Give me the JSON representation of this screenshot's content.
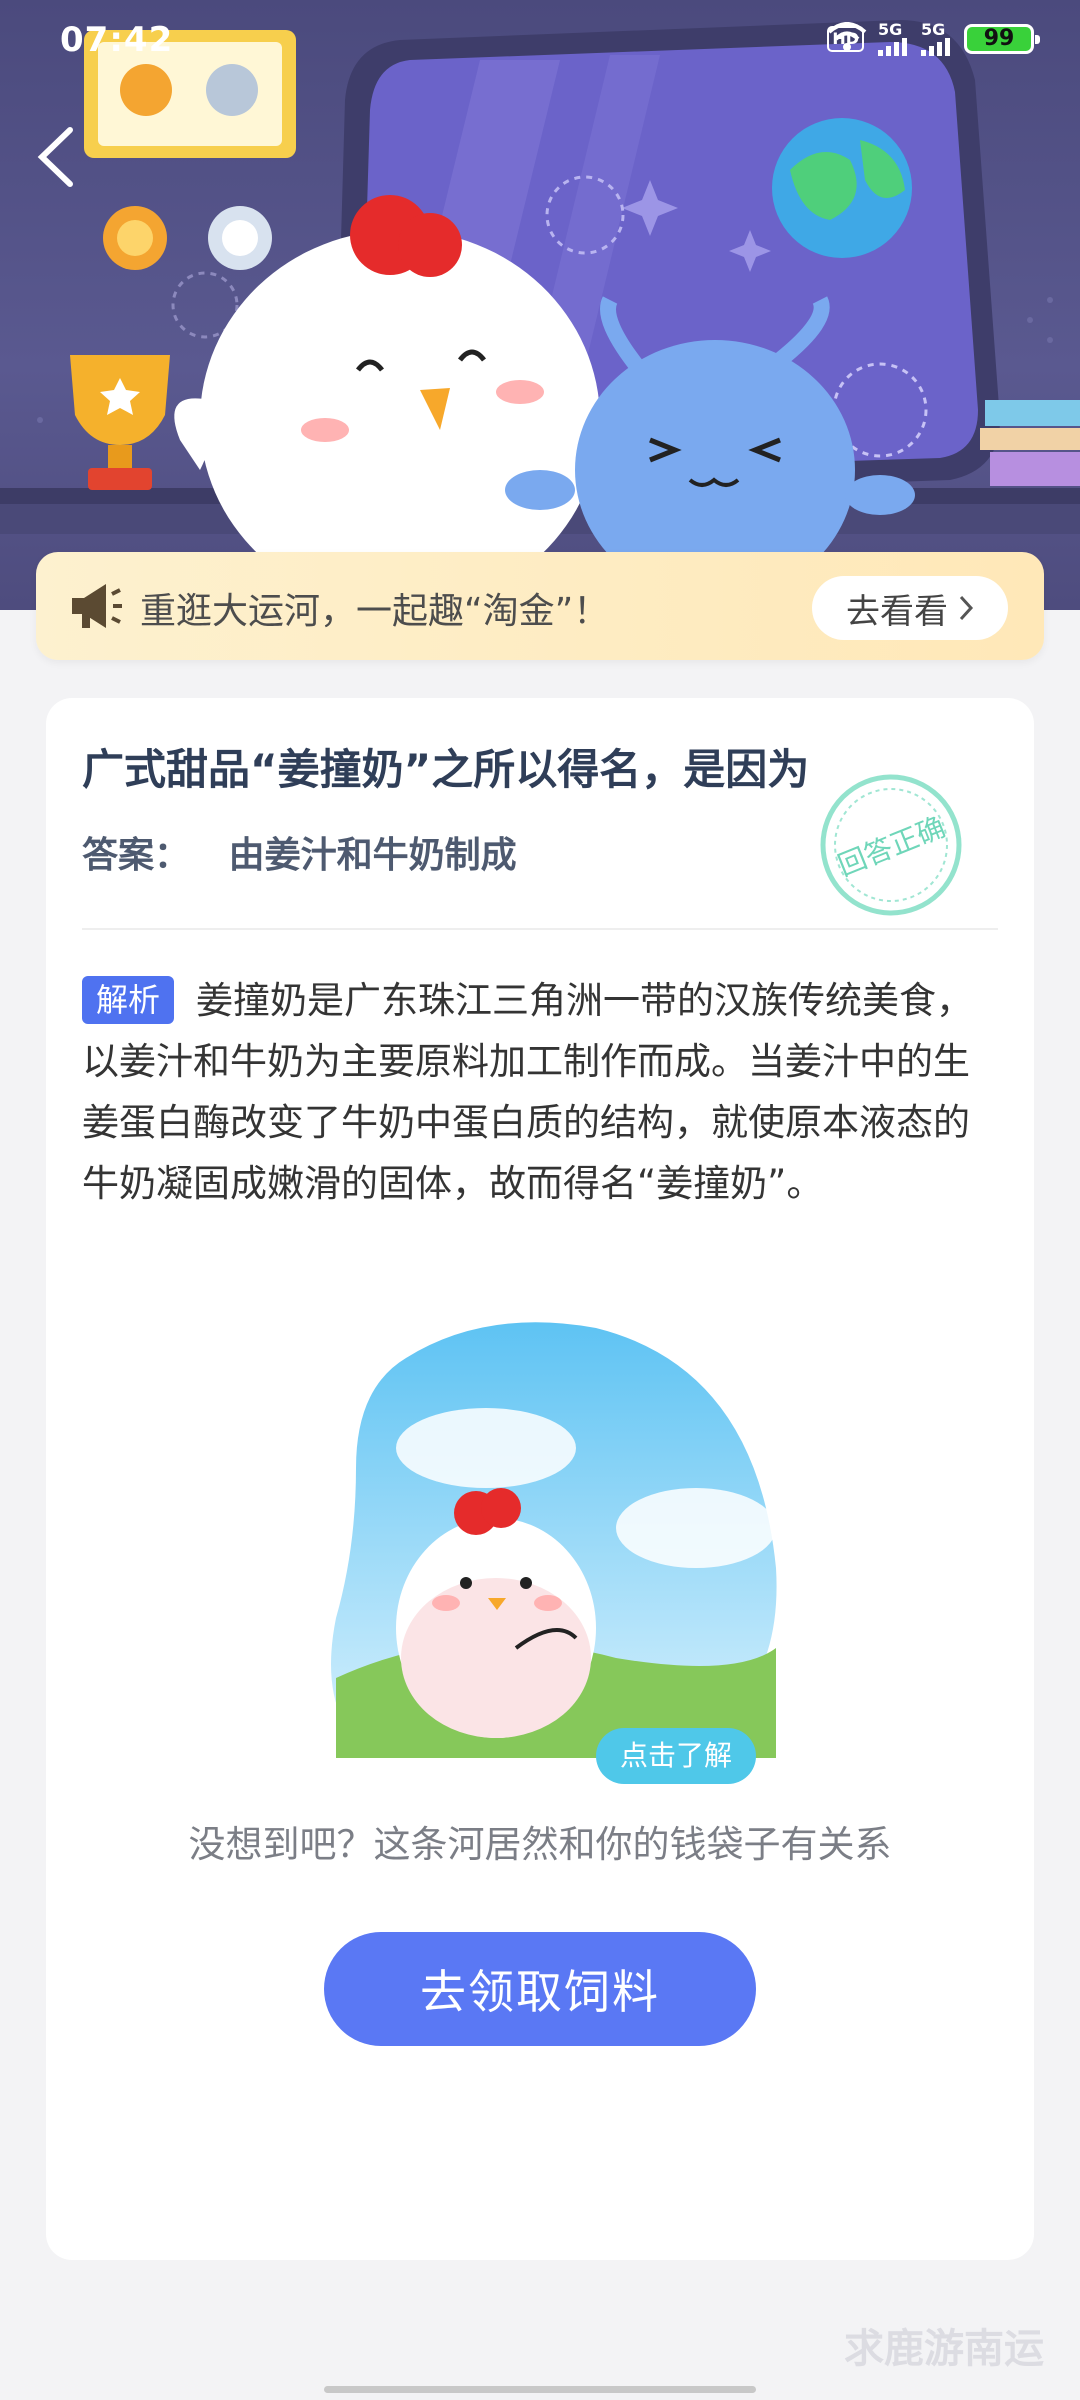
{
  "status_bar": {
    "time": "07:42",
    "network_1": "5G",
    "network_2": "5G",
    "hd": "HD",
    "battery": "99"
  },
  "notice": {
    "text": "重逛大运河，一起趣“淘金”！",
    "button_label": "去看看",
    "button_icon": "chevron-right-icon"
  },
  "question": {
    "title": "广式甜品“姜撞奶”之所以得名，是因为",
    "answer_label": "答案：",
    "answer_text": "由姜汁和牛奶制成",
    "stamp_text": "回答正确"
  },
  "analysis": {
    "badge": "解析",
    "text": "姜撞奶是广东珠江三角洲一带的汉族传统美食，以姜汁和牛奶为主要原料加工制作而成。当姜汁中的生姜蛋白酶改变了牛奶中蛋白质的结构，就使原本液态的牛奶凝固成嫩滑的固体，故而得名“姜撞奶”。"
  },
  "promo": {
    "tag": "点击了解",
    "caption": "没想到吧？这条河居然和你的钱袋子有关系"
  },
  "cta": {
    "label": "去领取饲料"
  },
  "watermark": "求鹿游南运",
  "colors": {
    "header_bg": "#4b4a7d",
    "accent_blue": "#5a78f4",
    "badge_blue": "#4f72f0",
    "notice_bg": "#fdf1cf",
    "stamp_green": "#5fd3b0"
  }
}
